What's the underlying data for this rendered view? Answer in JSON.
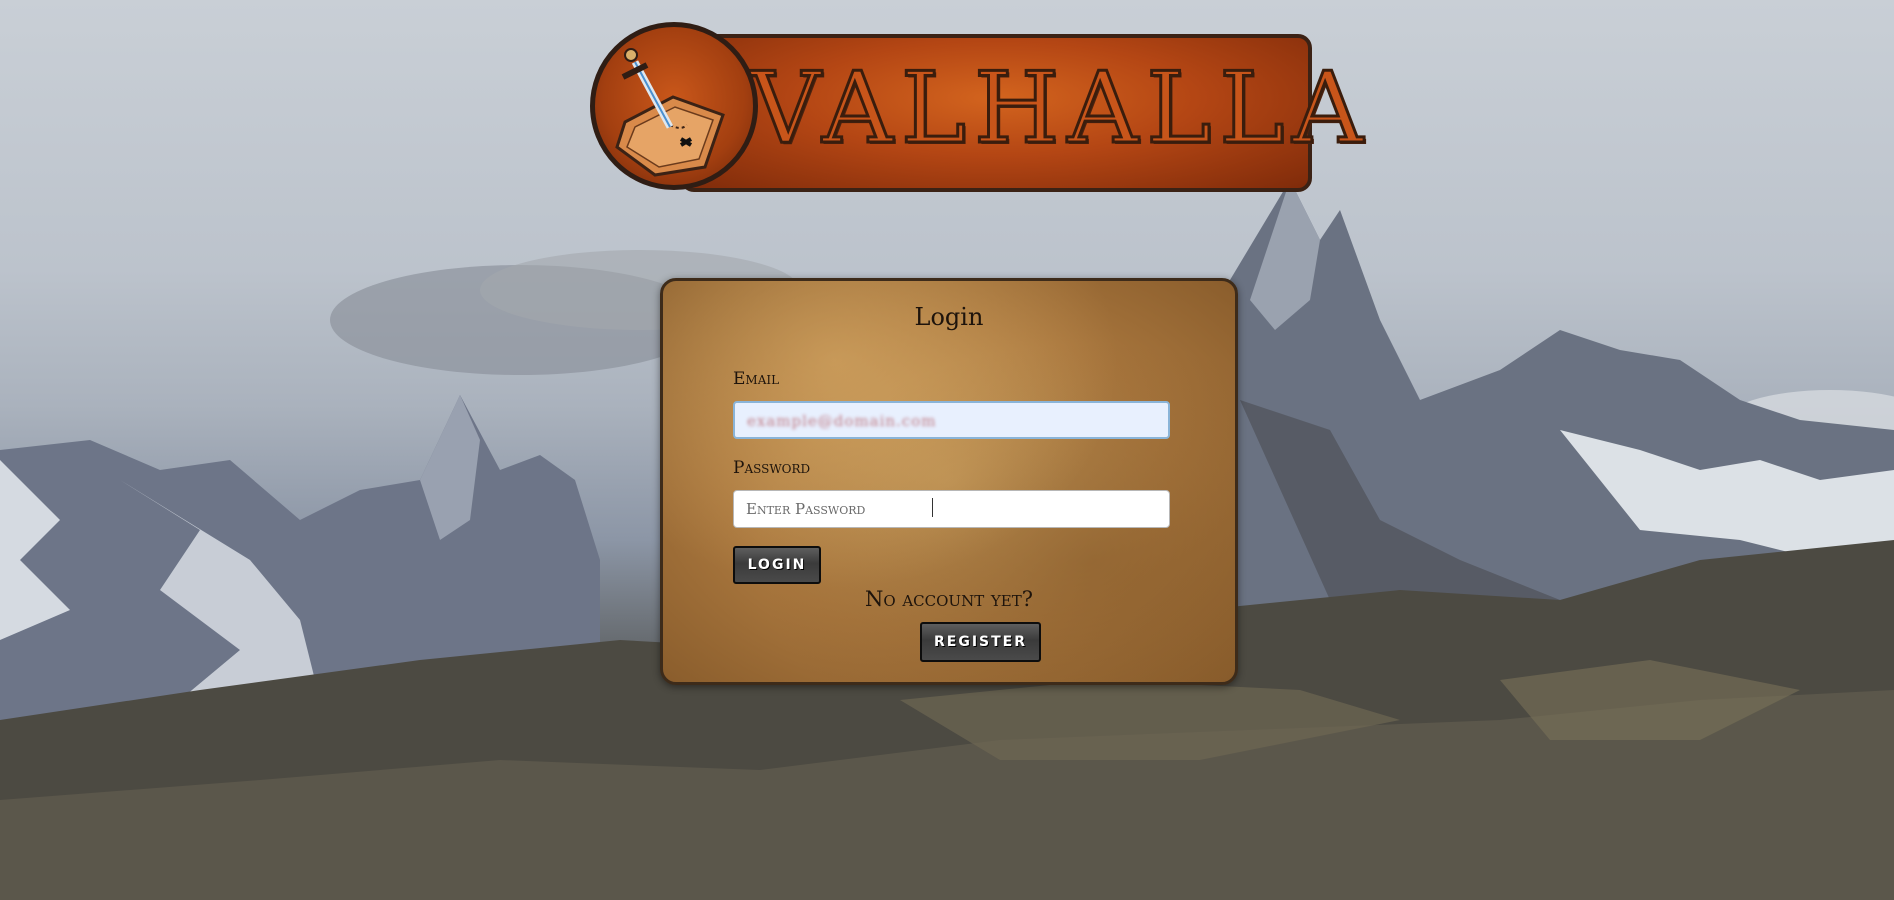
{
  "branding": {
    "logo_text": "VALHALLA"
  },
  "login_card": {
    "title": "Login",
    "email_label": "Email",
    "email_value": "example@domain.com",
    "password_label": "Password",
    "password_placeholder": "Enter Password",
    "login_button": "LOGIN",
    "no_account_text": "No account yet?",
    "register_button": "REGISTER"
  },
  "icons": {
    "logo_emblem": "sword-map-icon",
    "cursor": "text-cursor-icon"
  },
  "colors": {
    "banner": "#b44614",
    "card": "#a8763d",
    "button": "#3b3b3b"
  }
}
